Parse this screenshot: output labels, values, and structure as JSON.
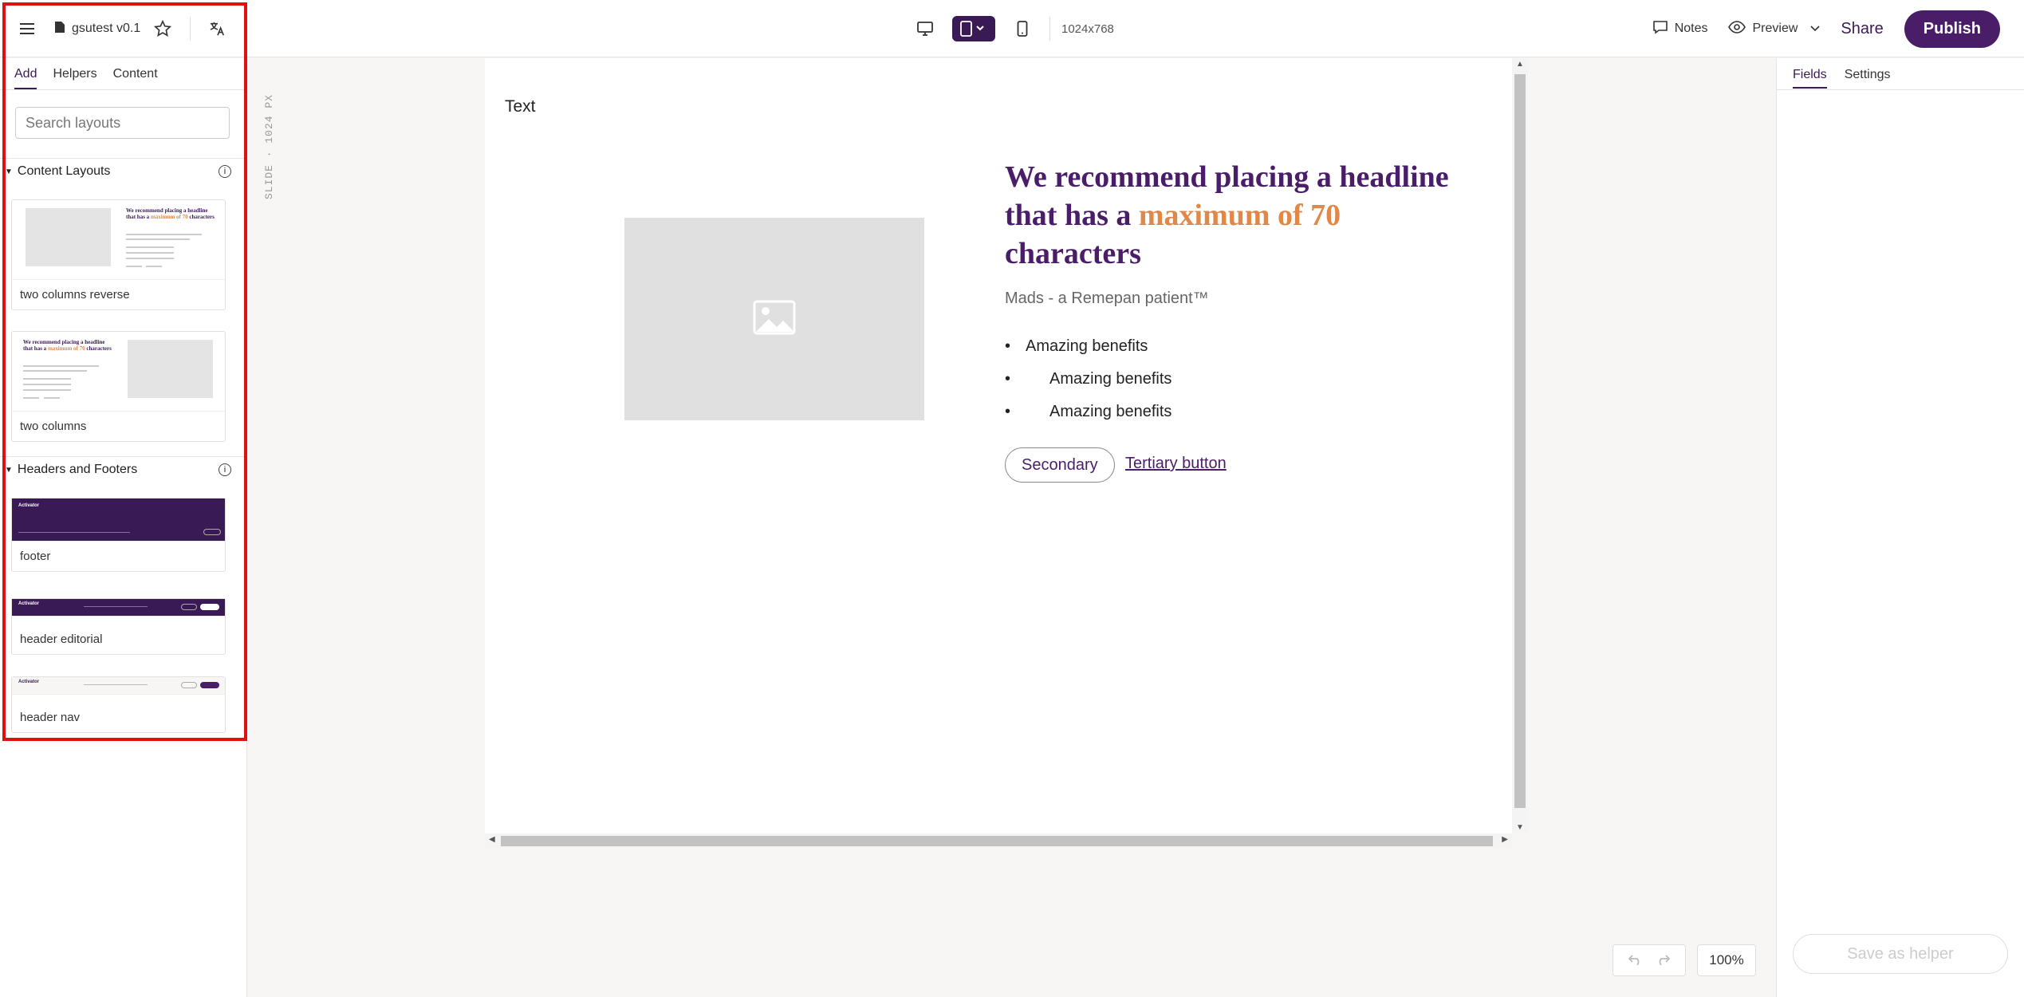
{
  "topbar": {
    "doc_name": "gsutest v0.1",
    "resolution": "1024x768",
    "notes_label": "Notes",
    "preview_label": "Preview",
    "share_label": "Share",
    "publish_label": "Publish"
  },
  "sidebar": {
    "tabs": [
      {
        "label": "Add",
        "active": true
      },
      {
        "label": "Helpers",
        "active": false
      },
      {
        "label": "Content",
        "active": false
      }
    ],
    "search_placeholder": "Search layouts",
    "sections": [
      {
        "title": "Content Layouts",
        "items": [
          {
            "label": "two columns reverse"
          },
          {
            "label": "two columns"
          }
        ]
      },
      {
        "title": "Headers and Footers",
        "items": [
          {
            "label": "footer"
          },
          {
            "label": "header editorial"
          },
          {
            "label": "header nav"
          }
        ]
      }
    ],
    "thumb_text": {
      "headline_a": "We recommend placing a headline that has a",
      "headline_b": "maximum of 70",
      "headline_c": "characters",
      "brand": "Activator"
    }
  },
  "canvas": {
    "slide_label": "SLIDE · 1024 PX",
    "text": "Text",
    "headline_part1": "We recommend placing a headline that has a ",
    "headline_highlight": "maximum of 70",
    "headline_part2": " characters",
    "subtitle": "Mads - a Remepan patient™",
    "bullets": [
      "Amazing benefits",
      "Amazing benefits",
      "Amazing benefits"
    ],
    "secondary_button": "Secondary",
    "tertiary_button": "Tertiary button"
  },
  "rightpanel": {
    "tabs": [
      {
        "label": "Fields",
        "active": true
      },
      {
        "label": "Settings",
        "active": false
      }
    ],
    "save_helper": "Save as helper"
  },
  "zoom": "100%",
  "colors": {
    "brand_purple": "#4a1d68",
    "accent_orange": "#e0884a",
    "highlight_frame": "#e01010"
  }
}
